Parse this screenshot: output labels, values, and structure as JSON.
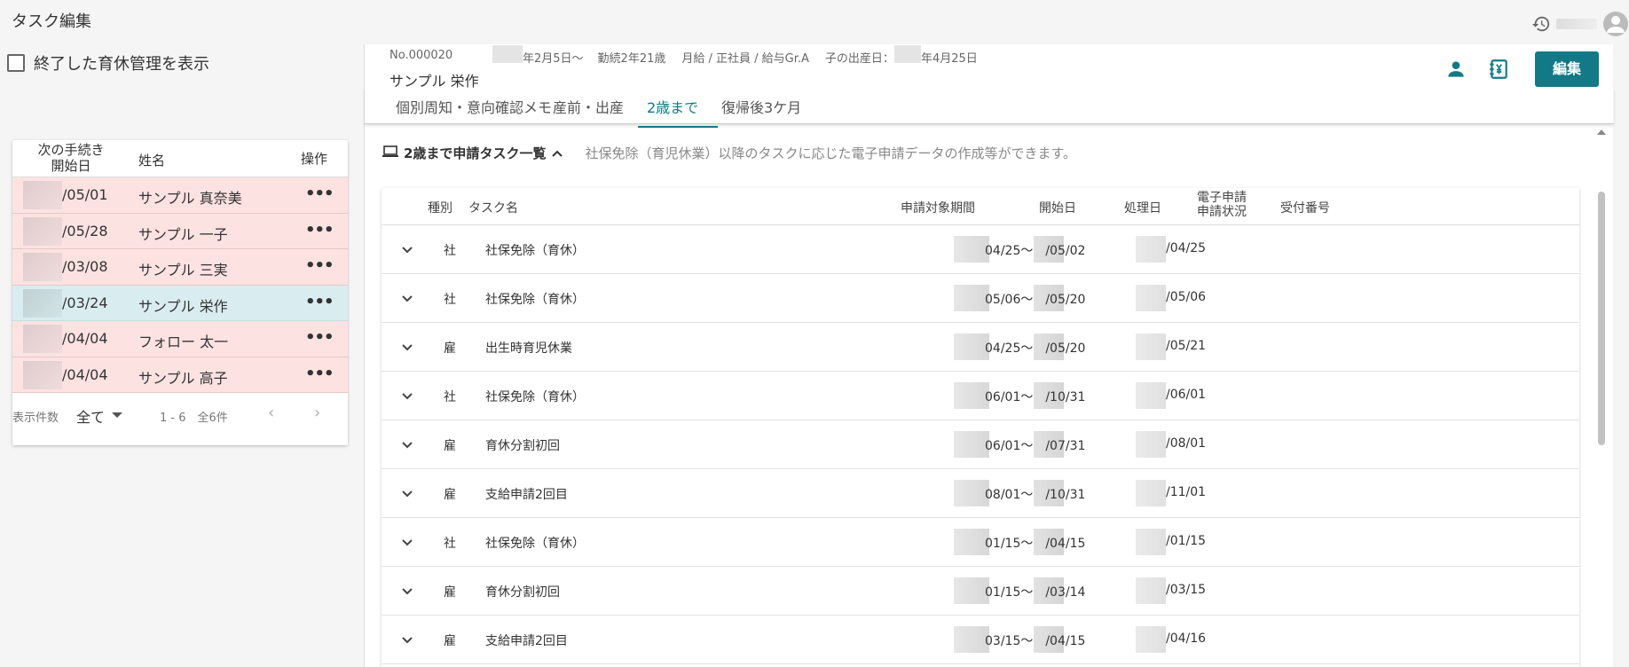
{
  "app": {
    "title": "タスク編集"
  },
  "left": {
    "show_finished_label": "終了した育休管理を表示",
    "columns": {
      "next_start": "次の手続き\n開始日",
      "name": "姓名",
      "ops": "操作"
    },
    "rows": [
      {
        "date": "/05/01",
        "name": "サンプル 真奈美",
        "more": "•••"
      },
      {
        "date": "/05/28",
        "name": "サンプル 一子",
        "more": "•••"
      },
      {
        "date": "/03/08",
        "name": "サンプル 三実",
        "more": "•••"
      },
      {
        "date": "/03/24",
        "name": "サンプル 栄作",
        "more": "•••"
      },
      {
        "date": "/04/04",
        "name": "フォロー 太一",
        "more": "•••"
      },
      {
        "date": "/04/04",
        "name": "サンプル 高子",
        "more": "•••"
      }
    ],
    "footer": {
      "per_page_label": "表示件数",
      "per_page_value": "全て",
      "range": "1 - 6　全6件"
    }
  },
  "employee": {
    "number": "No.000020",
    "hire": "年2月5日〜",
    "tenure": "勤続2年21歳",
    "employment": "月給 / 正社員 / 給与Gr.A",
    "birth_label": "子の出産日：",
    "birth_date": "年4月25日",
    "name": "サンプル 栄作",
    "edit_label": "編集"
  },
  "tabs": [
    {
      "label": "個別周知・意向確認メモ"
    },
    {
      "label": "産前・出産"
    },
    {
      "label": "2歳まで"
    },
    {
      "label": "復帰後3ケ月"
    }
  ],
  "section": {
    "title": "2歳まで申請タスク一覧",
    "description": "社保免除（育児休業）以降のタスクに応じた電子申請データの作成等ができます。"
  },
  "table": {
    "headers": {
      "kind": "種別",
      "task": "タスク名",
      "period": "申請対象期間",
      "start": "開始日",
      "processed": "処理日",
      "e_status": "電子申請\n申請状況",
      "receipt": "受付番号"
    },
    "rows": [
      {
        "kind": "社",
        "task": "社保免除（育休）",
        "period": "04/25〜　/05/02",
        "start": "/04/25"
      },
      {
        "kind": "社",
        "task": "社保免除（育休）",
        "period": "05/06〜　/05/20",
        "start": "/05/06"
      },
      {
        "kind": "雇",
        "task": "出生時育児休業",
        "period": "04/25〜　/05/20",
        "start": "/05/21"
      },
      {
        "kind": "社",
        "task": "社保免除（育休）",
        "period": "06/01〜　/10/31",
        "start": "/06/01"
      },
      {
        "kind": "雇",
        "task": "育休分割初回",
        "period": "06/01〜　/07/31",
        "start": "/08/01"
      },
      {
        "kind": "雇",
        "task": "支給申請2回目",
        "period": "08/01〜　/10/31",
        "start": "/11/01"
      },
      {
        "kind": "社",
        "task": "社保免除（育休）",
        "period": "01/15〜　/04/15",
        "start": "/01/15"
      },
      {
        "kind": "雇",
        "task": "育休分割初回",
        "period": "01/15〜　/03/14",
        "start": "/03/15"
      },
      {
        "kind": "雇",
        "task": "支給申請2回目",
        "period": "03/15〜　/04/15",
        "start": "/04/16"
      }
    ]
  },
  "colors": {
    "accent": "#137986",
    "row_pink": "#fde2e2",
    "row_selected": "#d9edf0"
  }
}
